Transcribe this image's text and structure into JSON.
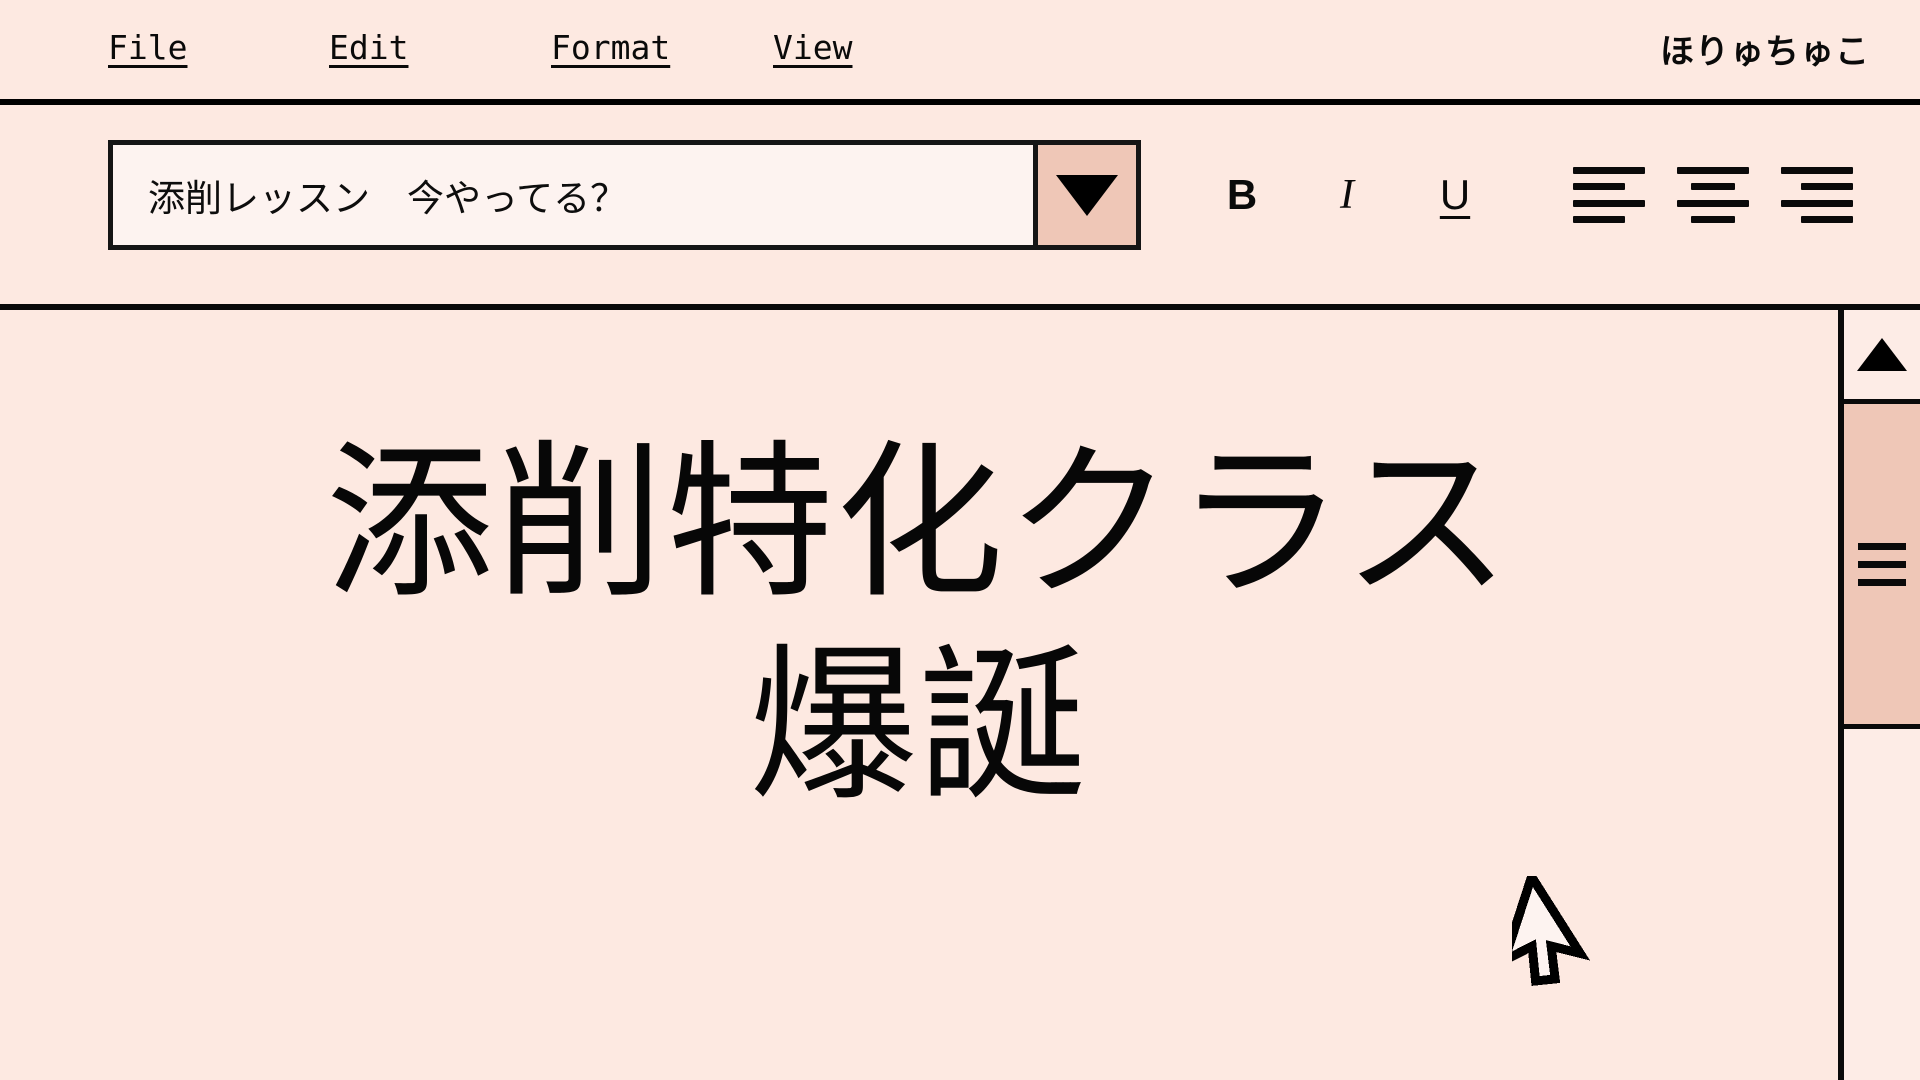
{
  "window": {
    "background_color": "#fde9e1",
    "accent_color": "#efc7b7",
    "line_color": "#0a0a0a"
  },
  "menubar": {
    "items": [
      {
        "label": "File",
        "name": "menu-item-file"
      },
      {
        "label": "Edit",
        "name": "menu-item-edit"
      },
      {
        "label": "Format",
        "name": "menu-item-format"
      },
      {
        "label": "View",
        "name": "menu-item-view"
      }
    ],
    "user_name": "ほりゅちゅこ"
  },
  "toolbar": {
    "style_select": {
      "value": "添削レッスン　今やってる？",
      "arrow_icon": "chevron-down-icon"
    },
    "text_format": [
      {
        "label": "B",
        "name": "bold-button"
      },
      {
        "label": "I",
        "name": "italic-button"
      },
      {
        "label": "U",
        "name": "underline-button"
      }
    ],
    "alignment": [
      {
        "name": "align-left-button",
        "icon": "align-left-icon"
      },
      {
        "name": "align-center-button",
        "icon": "align-center-icon"
      },
      {
        "name": "align-right-button",
        "icon": "align-right-icon"
      }
    ]
  },
  "document": {
    "body_text": "添削特化クラス\n爆誕"
  },
  "scrollbar": {
    "up_arrow_icon": "triangle-up-icon",
    "thumb_grip_icon": "grip-lines-icon"
  },
  "pointer": {
    "icon": "arrow-cursor"
  }
}
